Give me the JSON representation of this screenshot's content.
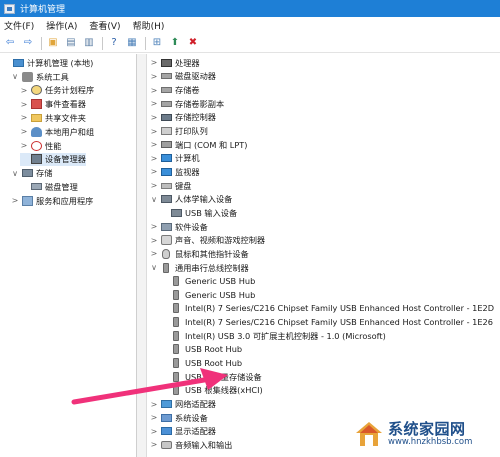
{
  "window": {
    "title": "计算机管理"
  },
  "menubar": {
    "items": [
      "文件(F)",
      "操作(A)",
      "查看(V)",
      "帮助(H)"
    ]
  },
  "toolbar": {
    "buttons": [
      {
        "name": "back",
        "glyph": "⇦",
        "color": "#3a7bd5"
      },
      {
        "name": "forward",
        "glyph": "⇨",
        "color": "#3a7bd5"
      },
      {
        "name": "up-folder",
        "glyph": "▣",
        "color": "#e0a53a"
      },
      {
        "name": "show-hide-tree",
        "glyph": "▤",
        "color": "#5b7da3"
      },
      {
        "name": "refresh",
        "glyph": "▥",
        "color": "#5b7da3"
      },
      {
        "name": "help",
        "glyph": "?",
        "color": "#2b5fa8"
      },
      {
        "name": "properties",
        "glyph": "▦",
        "color": "#4a7fb8"
      },
      {
        "name": "scan-hardware",
        "glyph": "⊞",
        "color": "#4a7fb8"
      },
      {
        "name": "update-driver",
        "glyph": "⬆",
        "color": "#2e8b57"
      },
      {
        "name": "uninstall-device",
        "glyph": "✖",
        "color": "#d0202a"
      }
    ]
  },
  "left_tree": {
    "items": [
      {
        "label": "计算机管理 (本地)",
        "icon": "computer-management-icon",
        "icon_class": "pc",
        "level": 0,
        "expander": ""
      },
      {
        "label": "系统工具",
        "icon": "system-tools-icon",
        "icon_class": "tool",
        "level": 1,
        "expander": "∨"
      },
      {
        "label": "任务计划程序",
        "icon": "task-scheduler-icon",
        "icon_class": "clock",
        "level": 2,
        "expander": ">"
      },
      {
        "label": "事件查看器",
        "icon": "event-viewer-icon",
        "icon_class": "event",
        "level": 2,
        "expander": ">"
      },
      {
        "label": "共享文件夹",
        "icon": "shared-folder-icon",
        "icon_class": "folder",
        "level": 2,
        "expander": ">"
      },
      {
        "label": "本地用户和组",
        "icon": "local-users-icon",
        "icon_class": "users",
        "level": 2,
        "expander": ">"
      },
      {
        "label": "性能",
        "icon": "performance-icon",
        "icon_class": "perf",
        "level": 2,
        "expander": ">"
      },
      {
        "label": "设备管理器",
        "icon": "device-manager-icon",
        "icon_class": "devmgr",
        "level": 2,
        "expander": "",
        "selected": true
      },
      {
        "label": "存储",
        "icon": "storage-icon",
        "icon_class": "storage",
        "level": 1,
        "expander": "∨"
      },
      {
        "label": "磁盘管理",
        "icon": "disk-management-icon",
        "icon_class": "disk",
        "level": 2,
        "expander": ""
      },
      {
        "label": "服务和应用程序",
        "icon": "services-apps-icon",
        "icon_class": "svc",
        "level": 1,
        "expander": ">"
      }
    ]
  },
  "device_tree": {
    "items": [
      {
        "label": "处理器",
        "icon": "processor-icon",
        "icon_class": "cpu",
        "level": 0,
        "expander": ">"
      },
      {
        "label": "磁盘驱动器",
        "icon": "disk-drive-icon",
        "icon_class": "drive",
        "level": 0,
        "expander": ">"
      },
      {
        "label": "存储卷",
        "icon": "storage-volume-icon",
        "icon_class": "drive",
        "level": 0,
        "expander": ">"
      },
      {
        "label": "存储卷影副本",
        "icon": "volume-shadow-copy-icon",
        "icon_class": "drive",
        "level": 0,
        "expander": ">"
      },
      {
        "label": "存储控制器",
        "icon": "storage-controller-icon",
        "icon_class": "chip",
        "level": 0,
        "expander": ">"
      },
      {
        "label": "打印队列",
        "icon": "print-queue-icon",
        "icon_class": "printer",
        "level": 0,
        "expander": ">"
      },
      {
        "label": "端口 (COM 和 LPT)",
        "icon": "port-icon",
        "icon_class": "port",
        "level": 0,
        "expander": ">"
      },
      {
        "label": "计算机",
        "icon": "computer-icon",
        "icon_class": "monitor",
        "level": 0,
        "expander": ">"
      },
      {
        "label": "监视器",
        "icon": "monitor-icon",
        "icon_class": "monitor",
        "level": 0,
        "expander": ">"
      },
      {
        "label": "键盘",
        "icon": "keyboard-icon",
        "icon_class": "keyboard",
        "level": 0,
        "expander": ">"
      },
      {
        "label": "人体学输入设备",
        "icon": "hid-icon",
        "icon_class": "hid",
        "level": 0,
        "expander": "∨"
      },
      {
        "label": "USB 输入设备",
        "icon": "hid-device-icon",
        "icon_class": "hid",
        "level": 1,
        "expander": ""
      },
      {
        "label": "软件设备",
        "icon": "software-device-icon",
        "icon_class": "soft",
        "level": 0,
        "expander": ">"
      },
      {
        "label": "声音、视频和游戏控制器",
        "icon": "audio-controller-icon",
        "icon_class": "audio",
        "level": 0,
        "expander": ">"
      },
      {
        "label": "鼠标和其他指针设备",
        "icon": "mouse-icon",
        "icon_class": "mouse",
        "level": 0,
        "expander": ">"
      },
      {
        "label": "通用串行总线控制器",
        "icon": "usb-controller-icon",
        "icon_class": "usbplug",
        "level": 0,
        "expander": "∨"
      },
      {
        "label": "Generic USB Hub",
        "icon": "usb-device-icon",
        "icon_class": "usbplug",
        "level": 1,
        "expander": ""
      },
      {
        "label": "Generic USB Hub",
        "icon": "usb-device-icon",
        "icon_class": "usbplug",
        "level": 1,
        "expander": ""
      },
      {
        "label": "Intel(R) 7 Series/C216 Chipset Family USB Enhanced Host Controller - 1E2D",
        "icon": "usb-device-icon",
        "icon_class": "usbplug",
        "level": 1,
        "expander": ""
      },
      {
        "label": "Intel(R) 7 Series/C216 Chipset Family USB Enhanced Host Controller - 1E26",
        "icon": "usb-device-icon",
        "icon_class": "usbplug",
        "level": 1,
        "expander": ""
      },
      {
        "label": "Intel(R) USB 3.0 可扩展主机控制器 - 1.0 (Microsoft)",
        "icon": "usb-device-icon",
        "icon_class": "usbplug",
        "level": 1,
        "expander": ""
      },
      {
        "label": "USB Root Hub",
        "icon": "usb-device-icon",
        "icon_class": "usbplug",
        "level": 1,
        "expander": ""
      },
      {
        "label": "USB Root Hub",
        "icon": "usb-device-icon",
        "icon_class": "usbplug",
        "level": 1,
        "expander": ""
      },
      {
        "label": "USB 大容量存储设备",
        "icon": "usb-device-icon",
        "icon_class": "usbplug",
        "level": 1,
        "expander": ""
      },
      {
        "label": "USB 根集线器(xHCI)",
        "icon": "usb-device-icon",
        "icon_class": "usbplug",
        "level": 1,
        "expander": ""
      },
      {
        "label": "网络适配器",
        "icon": "network-adapter-icon",
        "icon_class": "net",
        "level": 0,
        "expander": ">"
      },
      {
        "label": "系统设备",
        "icon": "system-device-icon",
        "icon_class": "sys",
        "level": 0,
        "expander": ">"
      },
      {
        "label": "显示适配器",
        "icon": "display-adapter-icon",
        "icon_class": "display",
        "level": 0,
        "expander": ">"
      },
      {
        "label": "音频输入和输出",
        "icon": "audio-io-icon",
        "icon_class": "audioio",
        "level": 0,
        "expander": ">"
      }
    ]
  },
  "annotation": {
    "arrow_color": "#f0317a"
  },
  "watermark": {
    "cn": "系统家园网",
    "url": "www.hnzkhbsb.com",
    "color": "#1f4f8a"
  }
}
